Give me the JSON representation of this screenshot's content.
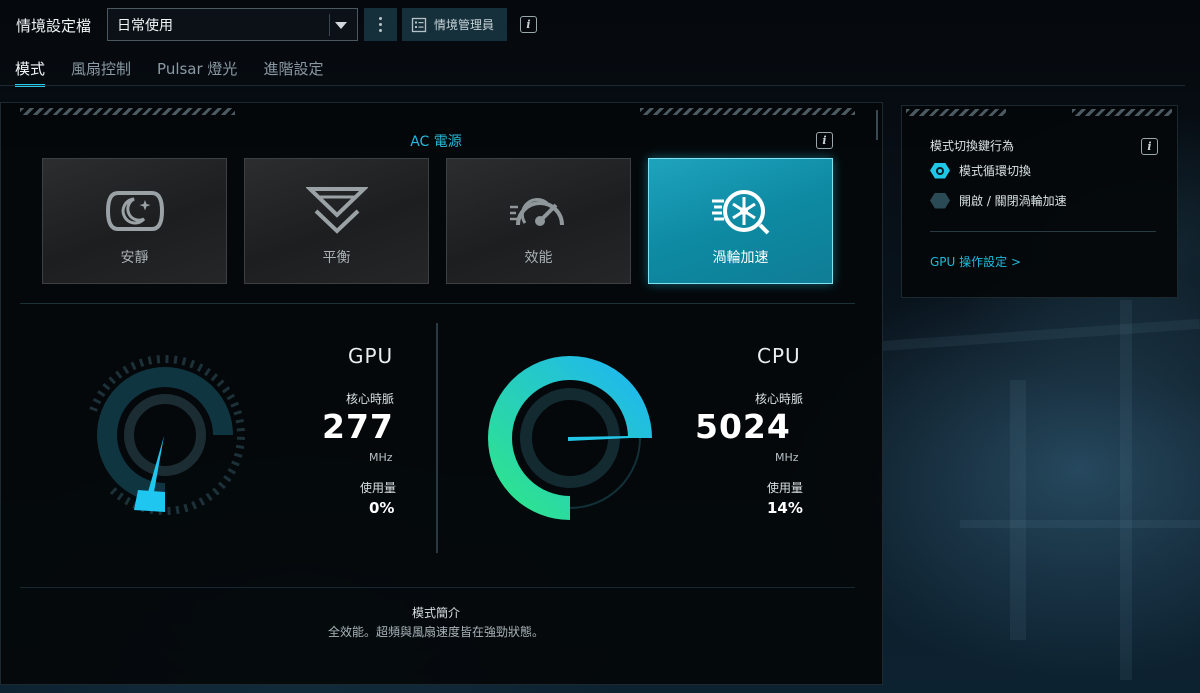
{
  "header": {
    "profile_label": "情境設定檔",
    "profile_value": "日常使用",
    "manager_label": "情境管理員",
    "info_glyph": "i"
  },
  "tabs": [
    {
      "label": "模式",
      "active": true
    },
    {
      "label": "風扇控制",
      "active": false
    },
    {
      "label": "Pulsar 燈光",
      "active": false
    },
    {
      "label": "進階設定",
      "active": false
    }
  ],
  "modes": {
    "power_label": "AC 電源",
    "items": [
      {
        "label": "安靜",
        "icon": "moon-shield-icon",
        "active": false
      },
      {
        "label": "平衡",
        "icon": "balance-chevron-icon",
        "active": false
      },
      {
        "label": "效能",
        "icon": "speedometer-icon",
        "active": false
      },
      {
        "label": "渦輪加速",
        "icon": "turbo-fan-icon",
        "active": true
      }
    ]
  },
  "gpu": {
    "title": "GPU",
    "clock_label": "核心時脈",
    "clock_value": "277",
    "clock_unit": "MHz",
    "usage_label": "使用量",
    "usage_value": "0%",
    "usage_fraction": 0.0
  },
  "cpu": {
    "title": "CPU",
    "clock_label": "核心時脈",
    "clock_value": "5024",
    "clock_unit": "MHz",
    "usage_label": "使用量",
    "usage_value": "14%",
    "usage_fraction": 0.14
  },
  "description": {
    "title": "模式簡介",
    "text": "全效能。超頻與風扇速度皆在強勁狀態。"
  },
  "side": {
    "title": "模式切換鍵行為",
    "options": [
      {
        "label": "模式循環切換",
        "selected": true
      },
      {
        "label": "開啟 / 關閉渦輪加速",
        "selected": false
      }
    ],
    "gpu_link": "GPU 操作設定 >"
  },
  "colors": {
    "accent": "#25c8e8",
    "turbo_card": "#1597b2",
    "gauge_cyan": "#1fc7f0",
    "gauge_green": "#2ee58a"
  }
}
